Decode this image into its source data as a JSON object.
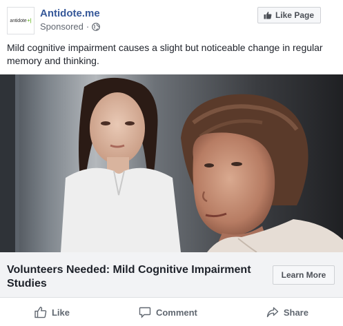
{
  "post": {
    "page_name": "Antidote.me",
    "sponsored_label": "Sponsored",
    "meta_separator": "·",
    "like_page_label": "Like Page",
    "logo_text": "antidote",
    "logo_mark": "+|",
    "body_text": "Mild cognitive impairment causes a slight but noticeable change in regular memory and thinking.",
    "image_subject": "Elderly woman looking ahead with younger woman in the background"
  },
  "cta": {
    "headline": "Volunteers Needed: Mild Cognitive Impairment Studies",
    "button_label": "Learn More"
  },
  "actions": {
    "like": "Like",
    "comment": "Comment",
    "share": "Share"
  },
  "icons": {
    "globe": "globe-icon",
    "thumb": "thumbs-up-icon",
    "comment": "comment-icon",
    "share": "share-icon"
  },
  "colors": {
    "link": "#365899",
    "text": "#1d2129",
    "muted": "#616770",
    "cta_bg": "#f2f3f5",
    "brand_green": "#7cc242"
  }
}
